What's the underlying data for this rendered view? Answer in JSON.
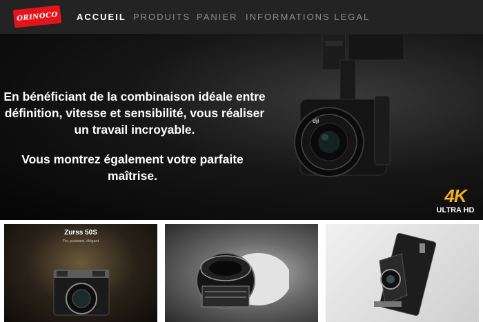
{
  "brand": {
    "logo_text": "ORINOCO",
    "logo_color": "#e5141b"
  },
  "nav": {
    "items": [
      {
        "label": "ACCUEIL",
        "active": true
      },
      {
        "label": "PRODUITS",
        "active": false
      },
      {
        "label": "PANIER",
        "active": false
      },
      {
        "label": "INFORMATIONS LEGAL",
        "active": false
      }
    ]
  },
  "hero": {
    "line1": "En bénéficiant de la combinaison idéale entre définition, vitesse et sensibilité, vous réaliser un travail incroyable.",
    "line2": "Vous montrez également votre parfaite maîtrise.",
    "camera_brand": "dji",
    "badge_main": "4K",
    "badge_sub": "ULTRA HD",
    "badge_color": "#f2b01e"
  },
  "products": [
    {
      "title": "Zurss 50S",
      "subtitle": "Fin, puissant, élégant"
    },
    {
      "title": "",
      "subtitle": ""
    },
    {
      "title": "",
      "subtitle": ""
    }
  ]
}
